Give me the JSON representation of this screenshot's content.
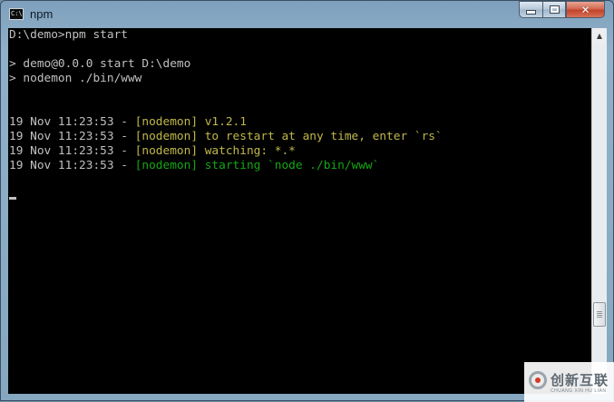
{
  "window": {
    "title": "npm",
    "icon": "console-icon",
    "icon_glyph": "C:\\",
    "buttons": {
      "minimize": "minimize-icon",
      "maximize": "maximize-icon",
      "close": "close-icon",
      "close_glyph": "✕"
    }
  },
  "console": {
    "lines": [
      {
        "prompt": "D:\\demo>npm start"
      },
      {
        "text": ""
      },
      {
        "text": "> demo@0.0.0 start D:\\demo"
      },
      {
        "text": "> nodemon ./bin/www"
      },
      {
        "text": ""
      },
      {
        "text": ""
      },
      {
        "time": "19 Nov 11:23:53 - ",
        "msg": "[nodemon] v1.2.1",
        "color": "yellow"
      },
      {
        "time": "19 Nov 11:23:53 - ",
        "msg": "[nodemon] to restart at any time, enter `rs`",
        "color": "yellow"
      },
      {
        "time": "19 Nov 11:23:53 - ",
        "msg": "[nodemon] watching: *.*",
        "color": "yellow"
      },
      {
        "time": "19 Nov 11:23:53 - ",
        "msg": "[nodemon] starting `node ./bin/www`",
        "color": "green"
      }
    ],
    "colors": {
      "background": "#000000",
      "text": "#c0c0c0",
      "yellow": "#c0b84a",
      "green": "#14a714"
    }
  },
  "scrollbar": {
    "up_arrow": "▲",
    "down_arrow": "▼"
  },
  "watermark": {
    "logo": "chuangxin-logo",
    "text": "创新互联",
    "subtext": "CHUANG XIN HU LIAN"
  }
}
